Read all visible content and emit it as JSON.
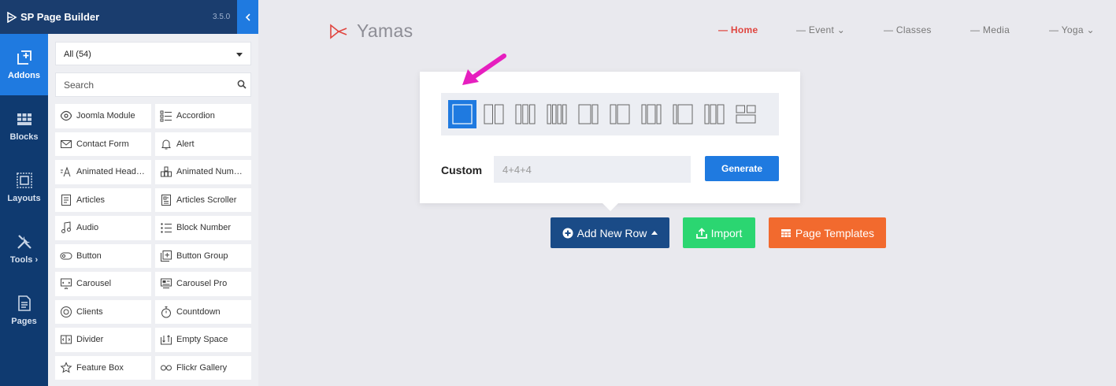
{
  "brand": {
    "title": "SP Page Builder",
    "version": "3.5.0",
    "collapse_icon": "chevron-left-icon"
  },
  "rail": [
    {
      "label": "Addons",
      "icon": "add-square-icon",
      "active": true
    },
    {
      "label": "Blocks",
      "icon": "blocks-grid-icon",
      "active": false
    },
    {
      "label": "Layouts",
      "icon": "layout-frame-icon",
      "active": false
    },
    {
      "label": "Tools ›",
      "icon": "tools-icon",
      "active": false
    },
    {
      "label": "Pages",
      "icon": "page-icon",
      "active": false
    }
  ],
  "panel": {
    "filter_value": "All (54)",
    "search_placeholder": "Search",
    "addons": [
      {
        "label": "Joomla Module",
        "icon": "joomla-icon"
      },
      {
        "label": "Accordion",
        "icon": "list-icon"
      },
      {
        "label": "Contact Form",
        "icon": "envelope-icon"
      },
      {
        "label": "Alert",
        "icon": "bell-icon"
      },
      {
        "label": "Animated Head…",
        "icon": "animated-text-icon"
      },
      {
        "label": "Animated Num…",
        "icon": "animated-number-icon"
      },
      {
        "label": "Articles",
        "icon": "articles-icon"
      },
      {
        "label": "Articles Scroller",
        "icon": "articles-scroller-icon"
      },
      {
        "label": "Audio",
        "icon": "music-note-icon"
      },
      {
        "label": "Block Number",
        "icon": "numbered-list-icon"
      },
      {
        "label": "Button",
        "icon": "button-icon"
      },
      {
        "label": "Button Group",
        "icon": "button-group-icon"
      },
      {
        "label": "Carousel",
        "icon": "carousel-icon"
      },
      {
        "label": "Carousel Pro",
        "icon": "carousel-pro-icon"
      },
      {
        "label": "Clients",
        "icon": "clients-icon"
      },
      {
        "label": "Countdown",
        "icon": "stopwatch-icon"
      },
      {
        "label": "Divider",
        "icon": "divider-icon"
      },
      {
        "label": "Empty Space",
        "icon": "empty-space-icon"
      },
      {
        "label": "Feature Box",
        "icon": "feature-box-icon"
      },
      {
        "label": "Flickr Gallery",
        "icon": "flickr-icon"
      }
    ]
  },
  "site": {
    "logo_text": "Yamas",
    "nav": [
      {
        "label": "— Home",
        "active": true
      },
      {
        "label": "— Event ⌄",
        "active": false
      },
      {
        "label": "— Classes",
        "active": false
      },
      {
        "label": "— Media",
        "active": false
      },
      {
        "label": "— Yoga ⌄",
        "active": false
      }
    ]
  },
  "popup": {
    "layouts": [
      "12",
      "6+6",
      "4+4+4",
      "3+3+3+3",
      "8+4",
      "4+8",
      "3+6+3",
      "2+10",
      "5+7",
      "custom-grid"
    ],
    "selected_layout": 0,
    "custom_label": "Custom",
    "custom_placeholder": "4+4+4",
    "generate_label": "Generate"
  },
  "actions": {
    "add_row": "Add New Row",
    "import": "Import",
    "templates": "Page Templates"
  },
  "colors": {
    "accent": "#1f7ae0",
    "rail": "#0f3a70",
    "import": "#2bd671",
    "templates": "#f26a2e",
    "annotation_arrow": "#e61fbf"
  }
}
